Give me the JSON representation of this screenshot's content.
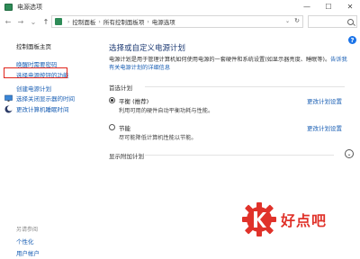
{
  "window": {
    "title": "电源选项"
  },
  "nav": {
    "back": "←",
    "forward": "→",
    "recent": "⌄",
    "up": "↑",
    "breadcrumbs": [
      "控制面板",
      "所有控制面板项",
      "电源选项"
    ]
  },
  "sidebar": {
    "home": "控制面板主页",
    "items": [
      {
        "label": "唤醒时需要密码"
      },
      {
        "label": "选择电源按钮的功能"
      },
      {
        "label": "创建电源计划"
      },
      {
        "label": "选择关闭显示器的时间"
      },
      {
        "label": "更改计算机睡眠时间"
      }
    ],
    "see_also": "另请参阅",
    "bottom_links": [
      "个性化",
      "用户帐户"
    ]
  },
  "main": {
    "title": "选择或自定义电源计划",
    "description": "电源计划是用于管理计算机如何使用电源的一套硬件和系统设置(如显示器亮度、睡眠等)。",
    "description_link": "告诉我有关电源计划的详细信息",
    "section_label": "首选计划",
    "plans": [
      {
        "name": "平衡 (推荐)",
        "desc": "利用可用的硬件自动平衡功耗与性能。",
        "link": "更改计划设置",
        "selected": true
      },
      {
        "name": "节能",
        "desc": "尽可能降低计算机性能以节能。",
        "link": "更改计划设置",
        "selected": false
      }
    ],
    "more_label": "显示附加计划"
  },
  "help": "?",
  "watermark": {
    "text": "好点吧"
  },
  "colors": {
    "link": "#1a5fb4",
    "title": "#1e3b74",
    "highlight": "#e0241b",
    "watermark": "#e0322a"
  }
}
